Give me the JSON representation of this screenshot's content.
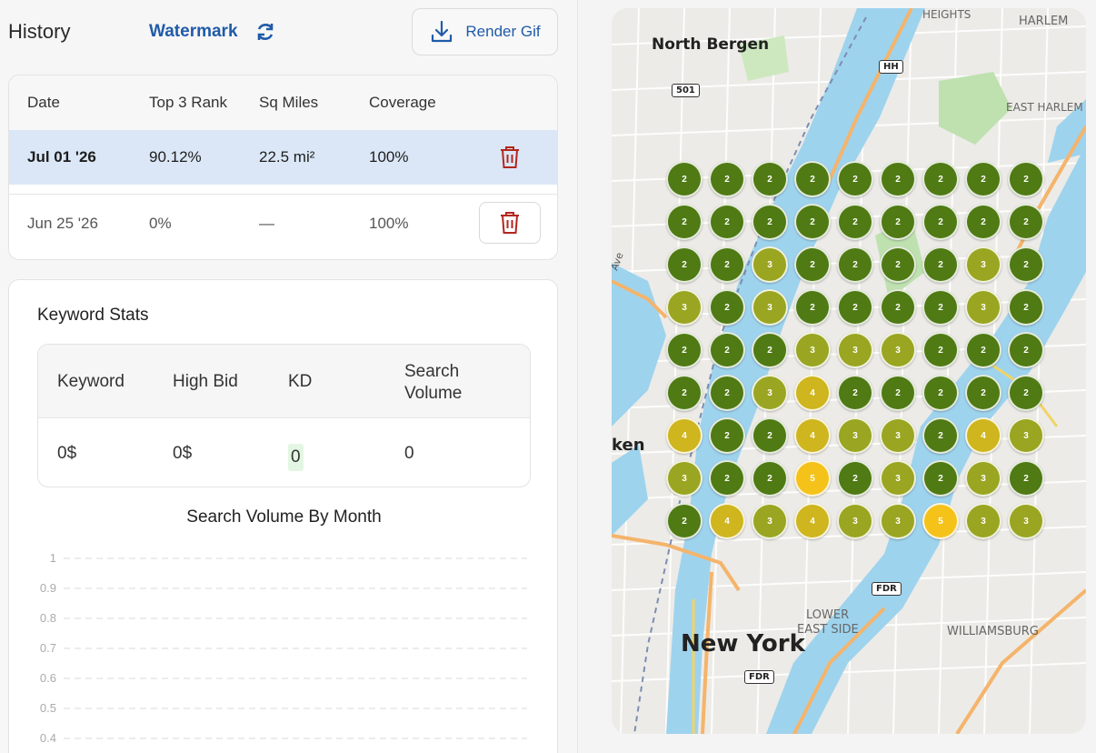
{
  "header": {
    "title": "History",
    "watermark_label": "Watermark",
    "render_label": "Render Gif"
  },
  "history": {
    "columns": [
      "Date",
      "Top 3 Rank",
      "Sq Miles",
      "Coverage"
    ],
    "rows": [
      {
        "date": "Jul 01 '26",
        "top3": "90.12%",
        "sqmiles": "22.5 mi²",
        "coverage": "100%"
      },
      {
        "date": "Jun 25 '26",
        "top3": "0%",
        "sqmiles": "—",
        "coverage": "100%"
      }
    ]
  },
  "keyword_stats": {
    "title": "Keyword Stats",
    "columns": [
      "Keyword",
      "High Bid",
      "KD",
      "Search\nVolume"
    ],
    "row": {
      "keyword": "0$",
      "high_bid": "0$",
      "kd": "0",
      "search_volume": "0"
    }
  },
  "chart_data": {
    "type": "line",
    "title": "Search Volume By Month",
    "y_ticks": [
      "1",
      "0.9",
      "0.8",
      "0.7",
      "0.6",
      "0.5",
      "0.4"
    ],
    "ylim": [
      0.4,
      1
    ],
    "grid": true,
    "series": []
  },
  "map": {
    "labels": {
      "north_bergen": "North Bergen",
      "heights": "HEIGHTS",
      "harlem": "HARLEM",
      "east_harlem": "EAST HARLEM",
      "new_york": "New York",
      "lower_east_side_1": "LOWER",
      "lower_east_side_2": "EAST SIDE",
      "williamsburg": "WILLIAMSBURG",
      "ken": "ken",
      "ave": "Ave"
    },
    "shields": {
      "s501": "501",
      "hh": "HH",
      "fdr1": "FDR",
      "fdr2": "FDR"
    },
    "rank_colors": {
      "2": "#4f7a14",
      "3": "#9aa521",
      "4": "#cfb51e",
      "5": "#f5c21a"
    },
    "grid": [
      [
        2,
        2,
        2,
        2,
        2,
        2,
        2,
        2,
        2
      ],
      [
        2,
        2,
        2,
        2,
        2,
        2,
        2,
        2,
        2
      ],
      [
        2,
        2,
        3,
        2,
        2,
        2,
        2,
        3,
        2
      ],
      [
        3,
        2,
        3,
        2,
        2,
        2,
        2,
        3,
        2
      ],
      [
        2,
        2,
        2,
        3,
        3,
        3,
        2,
        2,
        2
      ],
      [
        2,
        2,
        3,
        4,
        2,
        2,
        2,
        2,
        2
      ],
      [
        4,
        2,
        2,
        4,
        3,
        3,
        2,
        4,
        3
      ],
      [
        3,
        2,
        2,
        5,
        2,
        3,
        2,
        3,
        2
      ],
      [
        2,
        4,
        3,
        4,
        3,
        3,
        5,
        3,
        3
      ]
    ]
  }
}
